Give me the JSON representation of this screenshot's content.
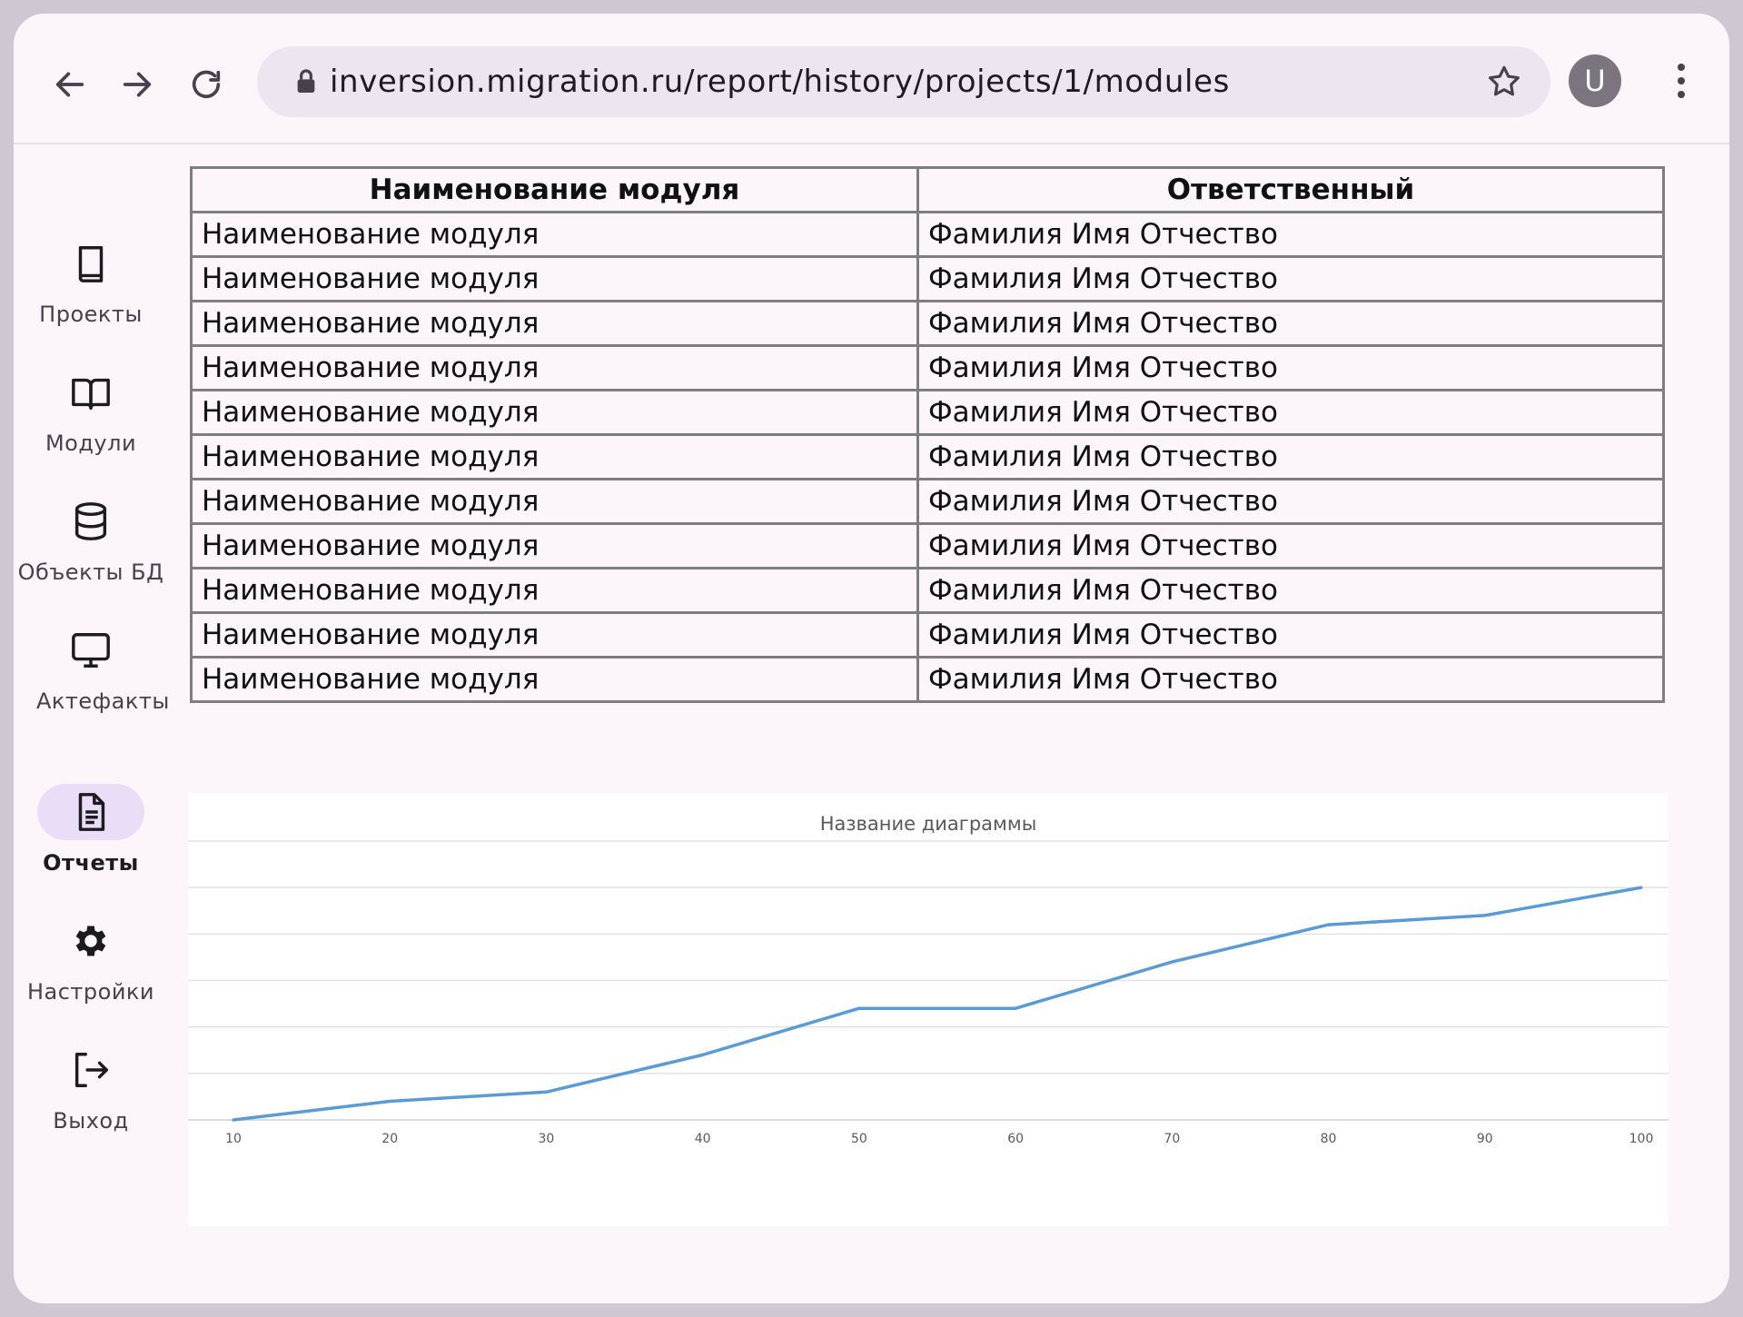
{
  "browser": {
    "url": "inversion.migration.ru/report/history/projects/1/modules",
    "avatar_letter": "U"
  },
  "sidebar": {
    "items": [
      {
        "label": "Проекты",
        "icon": "book-icon"
      },
      {
        "label": "Модули",
        "icon": "open-book-icon"
      },
      {
        "label": "Объекты БД",
        "icon": "database-icon"
      },
      {
        "label": "Актефакты",
        "icon": "monitor-icon"
      },
      {
        "label": "Отчеты",
        "icon": "document-icon",
        "active": true
      },
      {
        "label": "Настройки",
        "icon": "gear-icon"
      },
      {
        "label": "Выход",
        "icon": "logout-icon"
      }
    ]
  },
  "table": {
    "headers": [
      "Наименование модуля",
      "Ответственный"
    ],
    "rows": [
      [
        "Наименование модуля",
        "Фамилия Имя Отчество"
      ],
      [
        "Наименование модуля",
        "Фамилия Имя Отчество"
      ],
      [
        "Наименование модуля",
        "Фамилия Имя Отчество"
      ],
      [
        "Наименование модуля",
        "Фамилия Имя Отчество"
      ],
      [
        "Наименование модуля",
        "Фамилия Имя Отчество"
      ],
      [
        "Наименование модуля",
        "Фамилия Имя Отчество"
      ],
      [
        "Наименование модуля",
        "Фамилия Имя Отчество"
      ],
      [
        "Наименование модуля",
        "Фамилия Имя Отчество"
      ],
      [
        "Наименование модуля",
        "Фамилия Имя Отчество"
      ],
      [
        "Наименование модуля",
        "Фамилия Имя Отчество"
      ],
      [
        "Наименование модуля",
        "Фамилия Имя Отчество"
      ]
    ]
  },
  "chart_data": {
    "type": "line",
    "title": "Название диаграммы",
    "x": [
      10,
      20,
      30,
      40,
      50,
      60,
      70,
      80,
      90,
      100
    ],
    "series": [
      {
        "values": [
          0,
          0.6,
          0.9,
          2.1,
          3.6,
          3.6,
          5.1,
          6.3,
          6.6,
          7.5
        ]
      }
    ],
    "ylim": [
      0,
      9
    ],
    "grid": true,
    "line_color": "#5b9bd5"
  },
  "colors": {
    "accent_pill": "#e9ddf7",
    "border": "#7e7e80"
  }
}
